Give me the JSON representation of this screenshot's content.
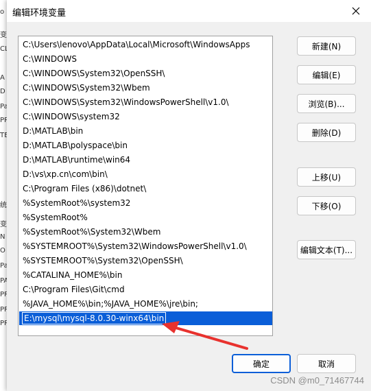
{
  "background_window": {
    "chars": [
      "o",
      "变",
      "CL",
      "A",
      "D",
      "Pa",
      "PR",
      "TE",
      "统",
      "变",
      "N",
      "O",
      "Pa",
      "PA",
      "PR",
      "PR",
      "PR"
    ]
  },
  "dialog": {
    "title": "编辑环境变量",
    "close_icon": "close-icon"
  },
  "list": {
    "items": [
      "C:\\Users\\lenovo\\AppData\\Local\\Microsoft\\WindowsApps",
      "C:\\WINDOWS",
      "C:\\WINDOWS\\System32\\OpenSSH\\",
      "C:\\WINDOWS\\System32\\Wbem",
      "C:\\WINDOWS\\System32\\WindowsPowerShell\\v1.0\\",
      "C:\\WINDOWS\\system32",
      "D:\\MATLAB\\bin",
      "D:\\MATLAB\\polyspace\\bin",
      "D:\\MATLAB\\runtime\\win64",
      "D:\\vs\\xp.cn\\com\\bin\\",
      "C:\\Program Files (x86)\\dotnet\\",
      "%SystemRoot%\\system32",
      "%SystemRoot%",
      "%SystemRoot%\\System32\\Wbem",
      "%SYSTEMROOT%\\System32\\WindowsPowerShell\\v1.0\\",
      "%SYSTEMROOT%\\System32\\OpenSSH\\",
      "%CATALINA_HOME%\\bin",
      "C:\\Program Files\\Git\\cmd",
      "%JAVA_HOME%\\bin;%JAVA_HOME%\\jre\\bin;"
    ],
    "selected_item_value": "E:\\mysql\\mysql-8.0.30-winx64\\bin"
  },
  "buttons": {
    "new": "新建(N)",
    "edit": "编辑(E)",
    "browse": "浏览(B)...",
    "delete": "删除(D)",
    "move_up": "上移(U)",
    "move_down": "下移(O)",
    "edit_text": "编辑文本(T)...",
    "ok": "确定",
    "cancel": "取消"
  },
  "annotation": {
    "arrow_color": "#e8322e"
  },
  "watermark": "CSDN @m0_71467744",
  "colors": {
    "selection": "#0a5ed8",
    "primary_border": "#0a5ed8"
  }
}
